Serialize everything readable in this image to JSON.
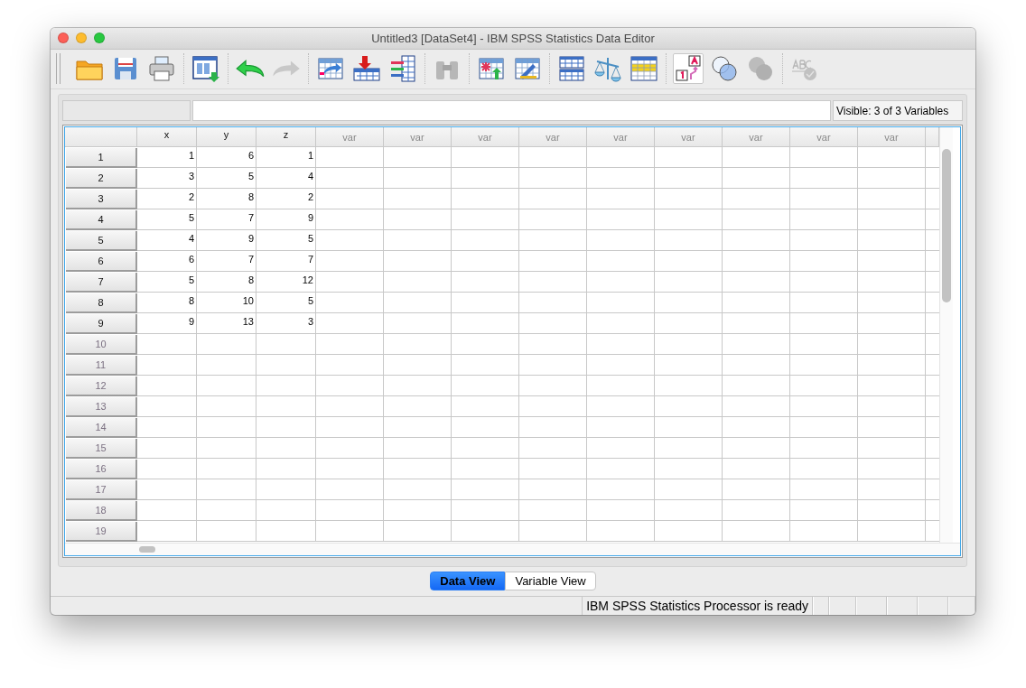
{
  "window": {
    "title": "Untitled3 [DataSet4] - IBM SPSS Statistics Data Editor"
  },
  "toolbar": [
    [
      {
        "kind": "open",
        "disabled": false,
        "selected": false
      },
      {
        "kind": "save",
        "disabled": false,
        "selected": false
      },
      {
        "kind": "print",
        "disabled": false,
        "selected": false
      }
    ],
    [
      {
        "kind": "recall",
        "disabled": false,
        "selected": false
      }
    ],
    [
      {
        "kind": "undo",
        "disabled": false,
        "selected": false
      },
      {
        "kind": "redo",
        "disabled": true,
        "selected": false
      }
    ],
    [
      {
        "kind": "goto_case",
        "disabled": false,
        "selected": false
      },
      {
        "kind": "goto_variable",
        "disabled": false,
        "selected": false
      },
      {
        "kind": "variables",
        "disabled": false,
        "selected": false
      }
    ],
    [
      {
        "kind": "find",
        "disabled": true,
        "selected": false
      }
    ],
    [
      {
        "kind": "insert_cases",
        "disabled": false,
        "selected": false
      },
      {
        "kind": "insert_variable",
        "disabled": false,
        "selected": false
      }
    ],
    [
      {
        "kind": "split",
        "disabled": false,
        "selected": false
      },
      {
        "kind": "weight",
        "disabled": false,
        "selected": false
      },
      {
        "kind": "select",
        "disabled": false,
        "selected": false
      }
    ],
    [
      {
        "kind": "value_labels",
        "disabled": false,
        "selected": true
      },
      {
        "kind": "use_sets",
        "disabled": false,
        "selected": false
      },
      {
        "kind": "show_all",
        "disabled": true,
        "selected": false
      }
    ],
    [
      {
        "kind": "spelling",
        "disabled": true,
        "selected": false
      }
    ]
  ],
  "visible_label": "Visible: 3 of 3 Variables",
  "table": {
    "columns": [
      {
        "name": "x",
        "kind": "variable"
      },
      {
        "name": "y",
        "kind": "variable"
      },
      {
        "name": "z",
        "kind": "variable"
      },
      {
        "name": "var",
        "kind": "empty"
      },
      {
        "name": "var",
        "kind": "empty"
      },
      {
        "name": "var",
        "kind": "empty"
      },
      {
        "name": "var",
        "kind": "empty"
      },
      {
        "name": "var",
        "kind": "empty"
      },
      {
        "name": "var",
        "kind": "empty"
      },
      {
        "name": "var",
        "kind": "empty"
      },
      {
        "name": "var",
        "kind": "empty"
      },
      {
        "name": "var",
        "kind": "empty"
      }
    ],
    "rows": [
      {
        "label": "1",
        "cells": [
          "1",
          "6",
          "1"
        ]
      },
      {
        "label": "2",
        "cells": [
          "3",
          "5",
          "4"
        ]
      },
      {
        "label": "3",
        "cells": [
          "2",
          "8",
          "2"
        ]
      },
      {
        "label": "4",
        "cells": [
          "5",
          "7",
          "9"
        ]
      },
      {
        "label": "5",
        "cells": [
          "4",
          "9",
          "5"
        ]
      },
      {
        "label": "6",
        "cells": [
          "6",
          "7",
          "7"
        ]
      },
      {
        "label": "7",
        "cells": [
          "5",
          "8",
          "12"
        ]
      },
      {
        "label": "8",
        "cells": [
          "8",
          "10",
          "5"
        ]
      },
      {
        "label": "9",
        "cells": [
          "9",
          "13",
          "3"
        ]
      },
      {
        "label": "10"
      },
      {
        "label": "11"
      },
      {
        "label": "12"
      },
      {
        "label": "13"
      },
      {
        "label": "14"
      },
      {
        "label": "15"
      },
      {
        "label": "16"
      },
      {
        "label": "17"
      },
      {
        "label": "18"
      },
      {
        "label": "19"
      }
    ]
  },
  "view_tabs": [
    {
      "label": "Data View",
      "selected": true
    },
    {
      "label": "Variable View",
      "selected": false
    }
  ],
  "status_bar": {
    "message": "IBM SPSS Statistics Processor is ready"
  }
}
